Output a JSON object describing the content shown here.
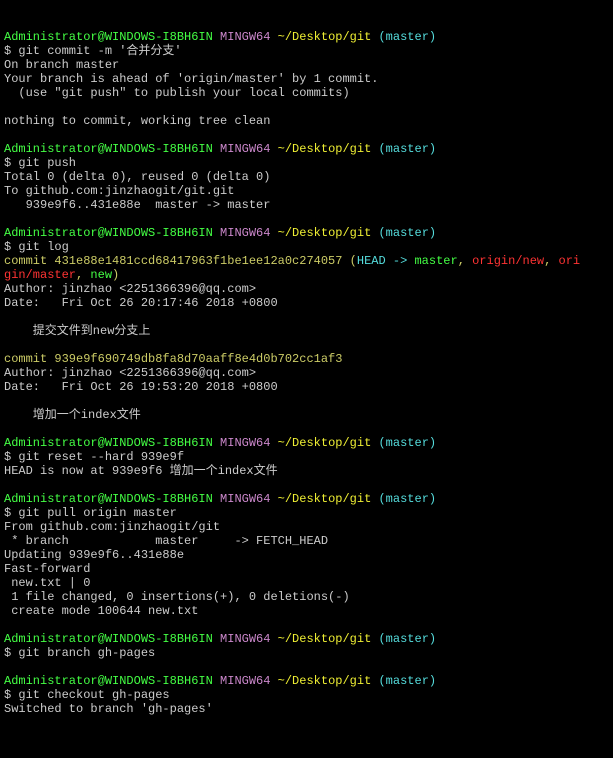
{
  "prompt_user": "Administrator@WINDOWS-I8BH6IN",
  "prompt_host": " MINGW64",
  "prompt_path": " ~/Desktop/git",
  "prompt_branch": " (master)",
  "blocks": {
    "b1": {
      "cmd": "$ git commit -m '合并分支'",
      "l1": "On branch master",
      "l2": "Your branch is ahead of 'origin/master' by 1 commit.",
      "l3": "  (use \"git push\" to publish your local commits)",
      "l4": "",
      "l5": "nothing to commit, working tree clean",
      "l6": ""
    },
    "b2": {
      "cmd": "$ git push",
      "l1": "Total 0 (delta 0), reused 0 (delta 0)",
      "l2": "To github.com:jinzhaogit/git.git",
      "l3": "   939e9f6..431e88e  master -> master",
      "l4": ""
    },
    "b3": {
      "cmd": "$ git log",
      "c1_p1": "commit 431e88e1481ccd68417963f1be1ee12a0c274057",
      "c1_paren_open": " (",
      "c1_head": "HEAD -> ",
      "c1_master": "master",
      "c1_sep0": ", ",
      "c1_on": "origin/new",
      "c1_sep1": ", ",
      "c1_om1": "ori",
      "c1_om2": "gin/master",
      "c1_sep2": ", ",
      "c1_new": "new",
      "c1_paren_close": ")",
      "c1_auth": "Author: jinzhao <2251366396@qq.com>",
      "c1_date": "Date:   Fri Oct 26 20:17:46 2018 +0800",
      "c1_msg": "    提交文件到new分支上",
      "c2_hash": "commit 939e9f690749db8fa8d70aaff8e4d0b702cc1af3",
      "c2_auth": "Author: jinzhao <2251366396@qq.com>",
      "c2_date": "Date:   Fri Oct 26 19:53:20 2018 +0800",
      "c2_msg": "    增加一个index文件"
    },
    "b4": {
      "cmd": "$ git reset --hard 939e9f",
      "l1": "HEAD is now at 939e9f6 增加一个index文件",
      "l2": ""
    },
    "b5": {
      "cmd": "$ git pull origin master",
      "l1": "From github.com:jinzhaogit/git",
      "l2": " * branch            master     -> FETCH_HEAD",
      "l3": "Updating 939e9f6..431e88e",
      "l4": "Fast-forward",
      "l5": " new.txt | 0",
      "l6": " 1 file changed, 0 insertions(+), 0 deletions(-)",
      "l7": " create mode 100644 new.txt",
      "l8": ""
    },
    "b6": {
      "cmd": "$ git branch gh-pages",
      "l1": ""
    },
    "b7": {
      "cmd": "$ git checkout gh-pages",
      "l1": "Switched to branch 'gh-pages'"
    }
  }
}
